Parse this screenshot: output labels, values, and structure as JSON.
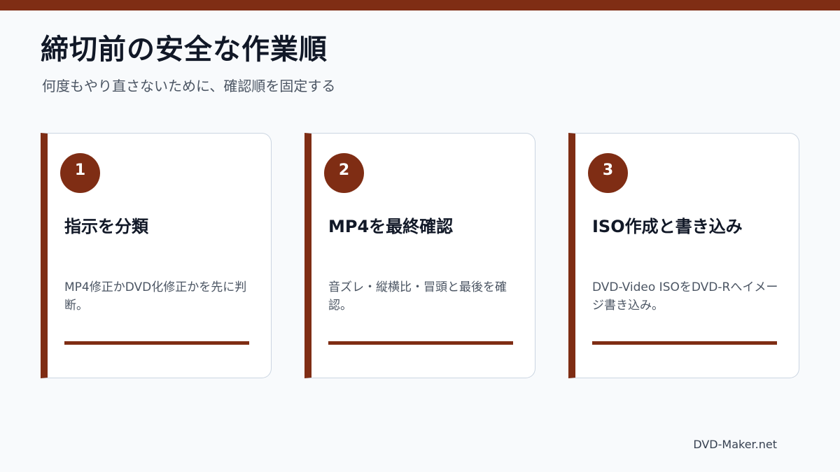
{
  "title": "締切前の安全な作業順",
  "subtitle": "何度もやり直さないために、確認順を固定する",
  "steps": [
    {
      "number": "1",
      "title": "指示を分類",
      "description": "MP4修正かDVD化修正かを先に判断。"
    },
    {
      "number": "2",
      "title": "MP4を最終確認",
      "description": "音ズレ・縦横比・冒頭と最後を確認。"
    },
    {
      "number": "3",
      "title": "ISO作成と書き込み",
      "description": "DVD-Video ISOをDVD-Rへイメージ書き込み。"
    }
  ],
  "footer": "DVD-Maker.net",
  "colors": {
    "accent": "#7f2d14",
    "background": "#f8fafc",
    "card_border": "#cbd5e1"
  }
}
